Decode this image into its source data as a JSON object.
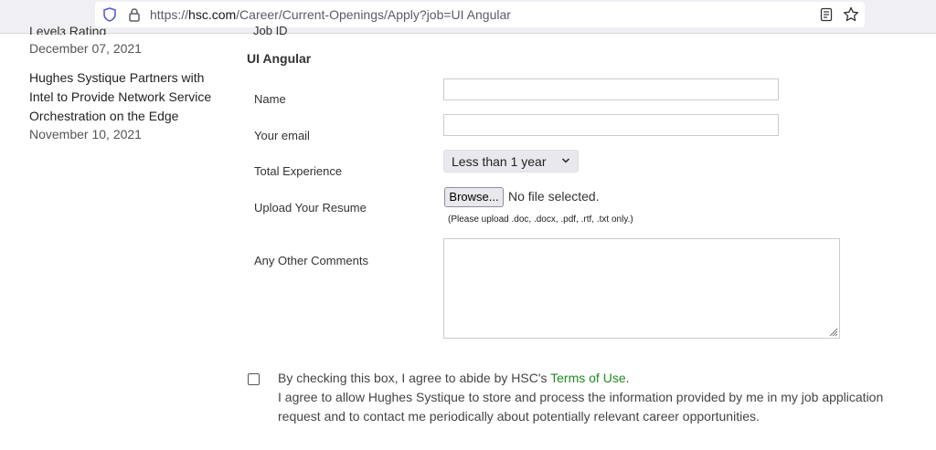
{
  "browser": {
    "url_prefix": "https://",
    "url_host": "hsc.com",
    "url_path": "/Career/Current-Openings/Apply?job=UI Angular"
  },
  "sidebar": {
    "cut_text": "Levelз Rating",
    "item1_date": "December 07, 2021",
    "item2_title": "Hughes Systique Partners with Intel to Provide Network Service Orchestration on the Edge",
    "item2_date": "November 10, 2021"
  },
  "form": {
    "job_id_cut": "Job ID",
    "job_title": "UI Angular",
    "name_label": "Name",
    "email_label": "Your email",
    "experience_label": "Total Experience",
    "experience_value": "Less than 1 year",
    "resume_label": "Upload Your Resume",
    "browse_label": "Browse...",
    "no_file_text": "No file selected.",
    "upload_hint": "(Please upload .doc, .docx, .pdf, .rtf, .txt only.)",
    "comments_label": "Any Other Comments",
    "consent_prefix": "By checking this box, I agree to abide by HSC's ",
    "consent_link": "Terms of Use",
    "consent_suffix": ".",
    "consent_line2": "I agree to allow Hughes Systique to store and process the information provided by me in my job application request and to contact me periodically about potentially relevant career opportunities."
  }
}
